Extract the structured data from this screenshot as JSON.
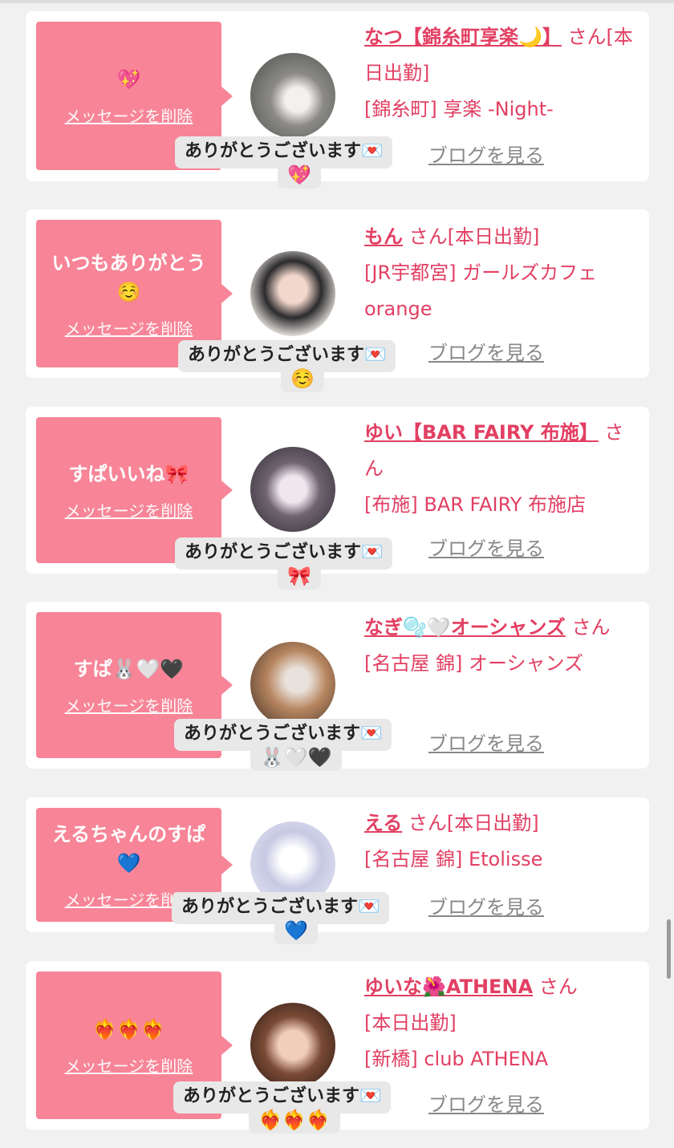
{
  "delete_label": "メッセージを削除",
  "blog_label": "ブログを見る",
  "reply_text": "ありがとうございます💌",
  "colors": {
    "bubble": "#f78597",
    "accent": "#e23f62",
    "card": "#ffffff",
    "page_bg": "#f1f1f1"
  },
  "cards": [
    {
      "message": "💖",
      "name": "なつ【錦糸町享楽🌙】",
      "san": "さん",
      "status": "[本日出勤]",
      "shop": "[錦糸町] 享楽 -Night-",
      "reply_emoji": "💖"
    },
    {
      "message": "いつもありがとう☺️",
      "name": "もん",
      "san": "さん",
      "status": "[本日出勤]",
      "shop": "[JR宇都宮] ガールズカフェorange",
      "reply_emoji": "☺️"
    },
    {
      "message": "すぱいいね🎀",
      "name": "ゆい【BAR FAIRY 布施】",
      "san": "さん",
      "status": "",
      "shop": "[布施] BAR FAIRY 布施店",
      "reply_emoji": "🎀"
    },
    {
      "message": "すぱ🐰🤍🖤",
      "name": "なぎ🫧🤍オーシャンズ",
      "san": "さん",
      "status": "",
      "shop": "[名古屋 錦] オーシャンズ",
      "reply_emoji": "🐰🤍🖤"
    },
    {
      "message": "えるちゃんのすぱ💙",
      "name": "える",
      "san": "さん",
      "status": "[本日出勤]",
      "shop": "[名古屋 錦] Etolisse",
      "reply_emoji": "💙"
    },
    {
      "message": "❤️‍🔥❤️‍🔥❤️‍🔥",
      "name": "ゆいな🌺ATHENA",
      "san": "さん",
      "status": "[本日出勤]",
      "shop": "[新橋] club ATHENA",
      "reply_emoji": "❤️‍🔥❤️‍🔥❤️‍🔥"
    }
  ]
}
